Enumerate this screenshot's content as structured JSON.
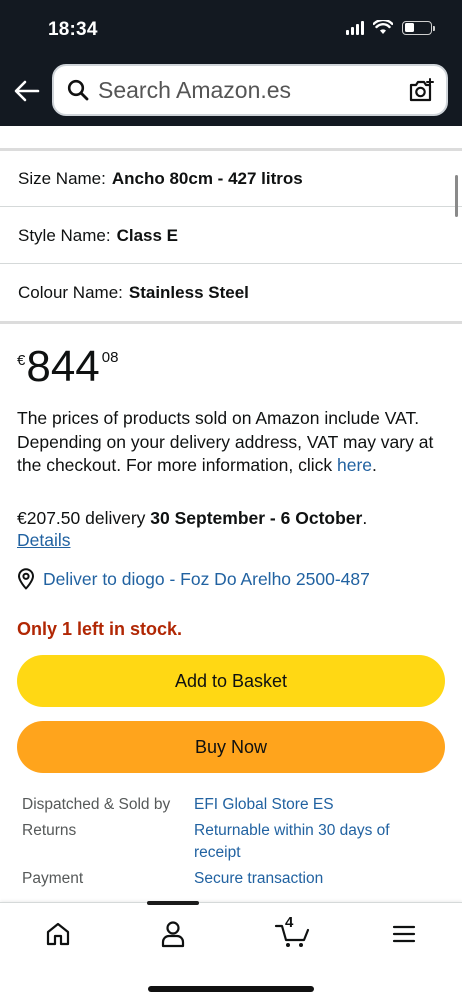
{
  "status_bar": {
    "time": "18:34"
  },
  "header": {
    "search_placeholder": "Search Amazon.es",
    "icons": {
      "back": "arrow-left-icon",
      "search": "search-icon",
      "camera": "camera-icon"
    }
  },
  "variations": [
    {
      "label": "Size Name:",
      "value": "Ancho 80cm - 427 litros"
    },
    {
      "label": "Style Name:",
      "value": "Class E"
    },
    {
      "label": "Colour Name:",
      "value": "Stainless Steel"
    }
  ],
  "price": {
    "currency": "€",
    "whole": "844",
    "fraction": "08"
  },
  "vat_note": {
    "text": "The prices of products sold on Amazon include VAT. Depending on your delivery address, VAT may vary at the checkout. For more information, click",
    "link": "here",
    "suffix": "."
  },
  "delivery": {
    "cost": "€207.50 delivery",
    "dates": "30 September - 6 October",
    "suffix": ".",
    "details_link": "Details"
  },
  "deliver_to": "Deliver to diogo - Foz Do Arelho 2500-487",
  "stock": "Only 1 left in stock.",
  "buttons": {
    "add_to_basket": "Add to Basket",
    "buy_now": "Buy Now"
  },
  "info": [
    {
      "key": "Dispatched & Sold by",
      "value": "EFI Global Store ES"
    },
    {
      "key": "Returns",
      "value": "Returnable within 30 days of receipt"
    },
    {
      "key": "Payment",
      "value": "Secure transaction"
    }
  ],
  "bottom_nav": {
    "cart_count": "4",
    "icons": [
      "home-icon",
      "account-icon",
      "cart-icon",
      "menu-icon"
    ]
  },
  "colors": {
    "header_bg": "#131921",
    "add_to_basket": "#ffd814",
    "buy_now": "#ffa41c",
    "link": "#2162a1",
    "stock_red": "#b12704"
  }
}
